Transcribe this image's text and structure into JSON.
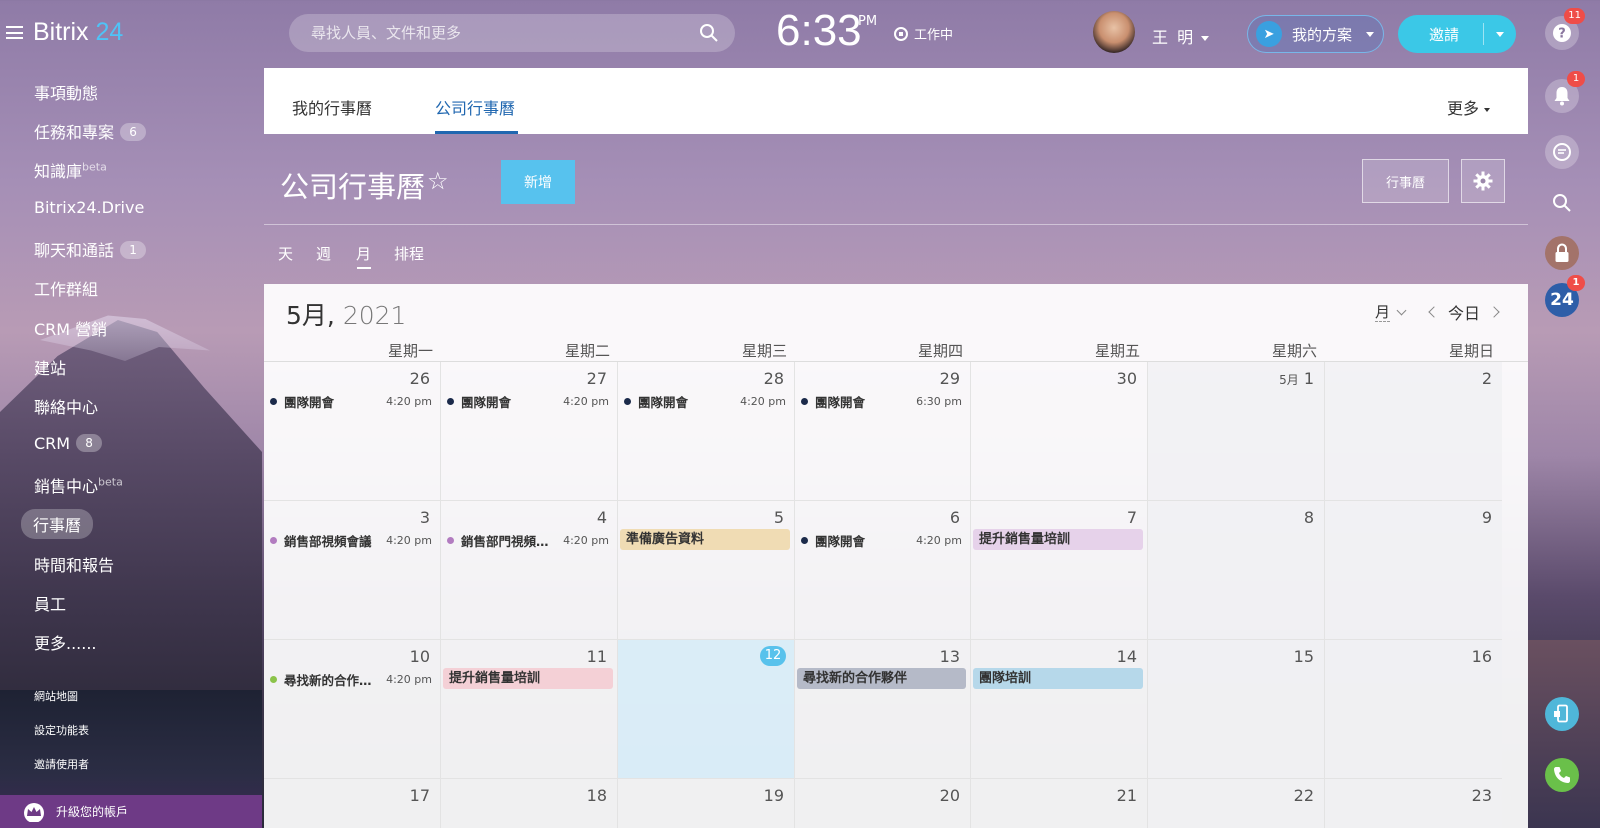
{
  "app": {
    "brand_name": "Bitrix",
    "brand_num": "24"
  },
  "header": {
    "search_placeholder": "尋找人員、文件和更多",
    "time": "6:33",
    "ampm": "PM",
    "work_status": "工作中",
    "user_name": "王 明",
    "plan_label": "我的方案",
    "invite_label": "邀請"
  },
  "sidebar": {
    "items": [
      {
        "label": "事項動態"
      },
      {
        "label": "任務和專案",
        "badge": "6"
      },
      {
        "label": "知識庫",
        "sup": "beta"
      },
      {
        "label": "Bitrix24.Drive"
      },
      {
        "label": "聊天和通話",
        "badge": "1"
      },
      {
        "label": "工作群組"
      },
      {
        "label": "CRM 營銷"
      },
      {
        "label": "建站"
      },
      {
        "label": "聯絡中心"
      },
      {
        "label": "CRM",
        "badge": "8"
      },
      {
        "label": "銷售中心",
        "sup": "beta"
      },
      {
        "label": "行事曆"
      },
      {
        "label": "時間和報告"
      },
      {
        "label": "員工"
      },
      {
        "label": "更多......"
      }
    ],
    "links": [
      "網站地圖",
      "設定功能表",
      "邀請使用者"
    ],
    "upgrade_label": "升級您的帳戶"
  },
  "tabs": {
    "my_calendar": "我的行事曆",
    "company_calendar": "公司行事曆",
    "more": "更多"
  },
  "page": {
    "title": "公司行事曆",
    "add_label": "新增",
    "calendars_label": "行事曆"
  },
  "views": [
    "天",
    "週",
    "月",
    "排程"
  ],
  "calendar": {
    "month_label": "5月,",
    "year_label": "2021",
    "view_select": "月",
    "today_label": "今日",
    "weekdays": [
      "星期一",
      "星期二",
      "星期三",
      "星期四",
      "星期五",
      "星期六",
      "星期日"
    ],
    "weeks": [
      {
        "days": [
          {
            "num": "26",
            "ev": {
              "text": "團隊開會",
              "time": "4:20 pm",
              "dot": "#1b2a4a"
            }
          },
          {
            "num": "27",
            "ev": {
              "text": "團隊開會",
              "time": "4:20 pm",
              "dot": "#1b2a4a"
            }
          },
          {
            "num": "28",
            "ev": {
              "text": "團隊開會",
              "time": "4:20 pm",
              "dot": "#1b2a4a"
            }
          },
          {
            "num": "29",
            "ev": {
              "text": "團隊開會",
              "time": "6:30 pm",
              "dot": "#1b2a4a"
            }
          },
          {
            "num": "30"
          },
          {
            "num": "1",
            "prefix": "5月"
          },
          {
            "num": "2"
          }
        ]
      },
      {
        "days": [
          {
            "num": "3",
            "ev": {
              "text": "銷售部視頻會議",
              "time": "4:20 pm",
              "dot": "#b27cc0"
            }
          },
          {
            "num": "4",
            "ev": {
              "text": "銷售部門視頻會...",
              "time": "4:20 pm",
              "dot": "#b27cc0"
            }
          },
          {
            "num": "5",
            "bar": {
              "text": "準備廣告資料",
              "color": "#f0dcb4"
            }
          },
          {
            "num": "6",
            "ev": {
              "text": "團隊開會",
              "time": "4:20 pm",
              "dot": "#1b2a4a"
            }
          },
          {
            "num": "7",
            "bar": {
              "text": "提升銷售量培訓",
              "color": "#e6d2ea"
            }
          },
          {
            "num": "8"
          },
          {
            "num": "9"
          }
        ]
      },
      {
        "days": [
          {
            "num": "10",
            "ev": {
              "text": "尋找新的合作夥...",
              "time": "4:20 pm",
              "dot": "#8bc34a"
            }
          },
          {
            "num": "11",
            "bar": {
              "text": "提升銷售量培訓",
              "color": "#f4d0d6"
            }
          },
          {
            "num": "12",
            "today": true
          },
          {
            "num": "13",
            "bar": {
              "text": "尋找新的合作夥伴",
              "color": "#b5bac8"
            }
          },
          {
            "num": "14",
            "bar": {
              "text": "團隊培訓",
              "color": "#b6d8ea"
            }
          },
          {
            "num": "15"
          },
          {
            "num": "16"
          }
        ]
      },
      {
        "days": [
          {
            "num": "17"
          },
          {
            "num": "18"
          },
          {
            "num": "19"
          },
          {
            "num": "20"
          },
          {
            "num": "21"
          },
          {
            "num": "22"
          },
          {
            "num": "23"
          }
        ]
      }
    ]
  },
  "rightbar": {
    "help_badge": "11",
    "bell_badge": "1",
    "b24_label": "24",
    "b24_badge": "1"
  }
}
